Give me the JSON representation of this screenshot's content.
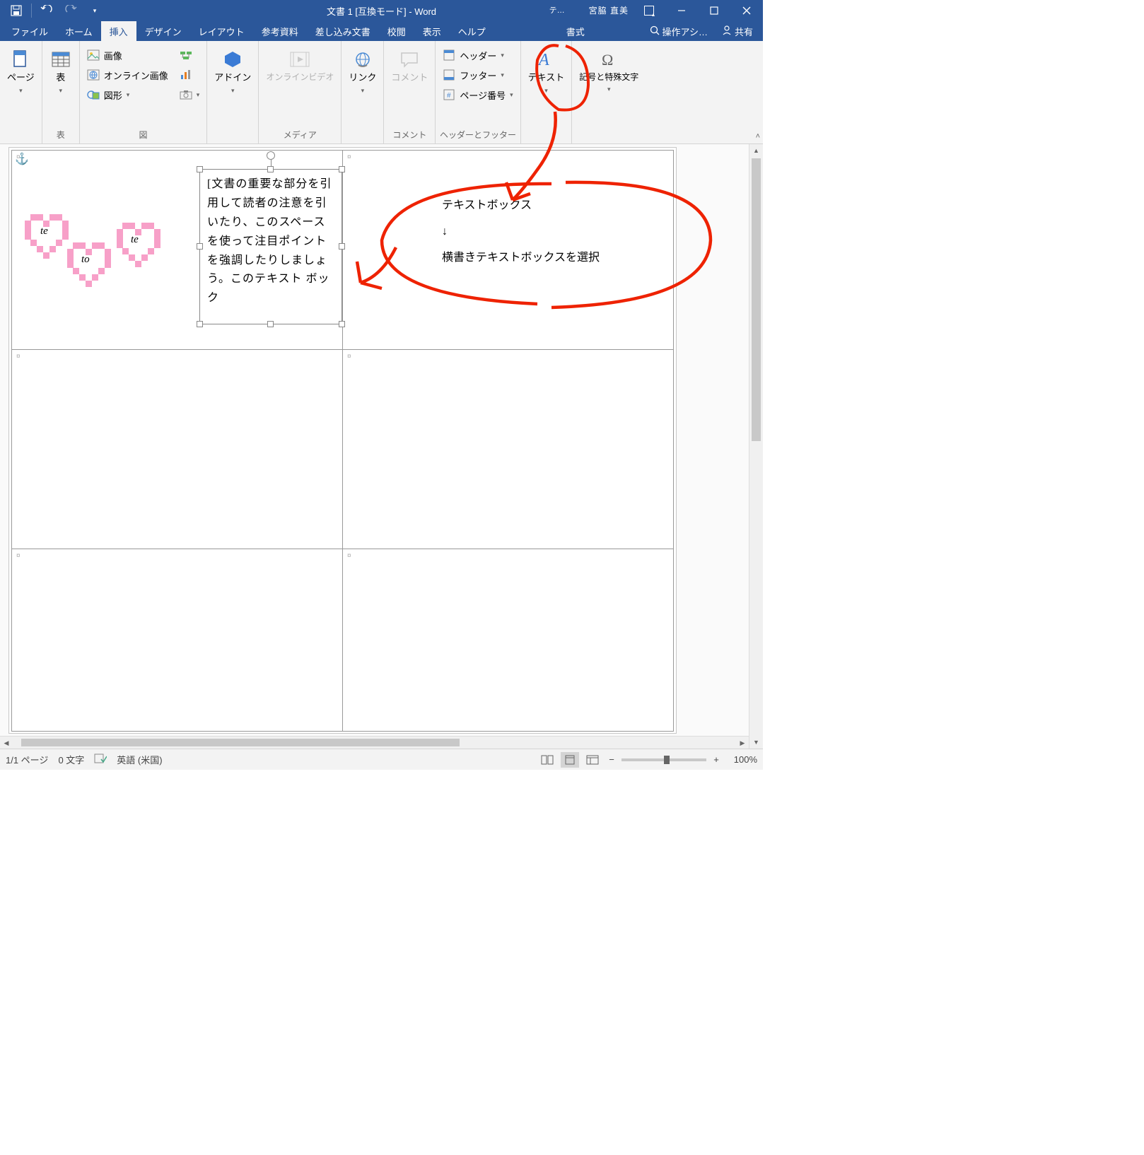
{
  "title": "文書 1 [互換モード] - Word",
  "contextual_tab": "…",
  "contextual_group": "書式",
  "qat": {
    "save": "保存",
    "undo": "元に戻す",
    "redo": "やり直し"
  },
  "window": {
    "minimize": "—",
    "maximize": "□",
    "close": "✕"
  },
  "ribbon_display": "リボン表示",
  "tabs": {
    "file": "ファイル",
    "home": "ホーム",
    "insert": "挿入",
    "design": "デザイン",
    "layout": "レイアウト",
    "references": "参考資料",
    "mailings": "差し込み文書",
    "review": "校閲",
    "view": "表示",
    "help": "ヘルプ",
    "format": "書式",
    "search_placeholder": "操作アシ…",
    "share": "共有"
  },
  "ribbon": {
    "groups": {
      "pages": {
        "btn": "ページ",
        "label": ""
      },
      "tables": {
        "btn": "表",
        "label": "表"
      },
      "illustrations": {
        "image": "画像",
        "online_image": "オンライン画像",
        "shapes": "図形",
        "icons": "",
        "smartart": "",
        "chart": "",
        "screenshot": "",
        "label": "図"
      },
      "addins": {
        "btn": "アドイン",
        "label": ""
      },
      "media": {
        "btn": "オンラインビデオ",
        "label": "メディア"
      },
      "links": {
        "btn": "リンク",
        "label": ""
      },
      "comments": {
        "btn": "コメント",
        "label": "コメント"
      },
      "headerfooter": {
        "header": "ヘッダー",
        "footer": "フッター",
        "pagenum": "ページ番号",
        "label": "ヘッダーとフッター"
      },
      "text": {
        "btn": "テキスト",
        "label": ""
      },
      "symbols": {
        "btn": "記号と特殊文字",
        "label": ""
      }
    }
  },
  "document": {
    "hearts": {
      "t1": "te",
      "t2": "to",
      "t3": "te"
    },
    "textbox": "[文書の重要な部分を引用して読者の注意を引いたり、このスペースを使って注目ポイントを強調したりしましょう。このテキスト ボック",
    "annotation": {
      "line1": "テキストボックス",
      "line2": "↓",
      "line3": "横書きテキストボックスを選択"
    }
  },
  "status": {
    "page": "1/1 ページ",
    "words": "0 文字",
    "lang": "英語 (米国)",
    "zoom": "100%"
  }
}
